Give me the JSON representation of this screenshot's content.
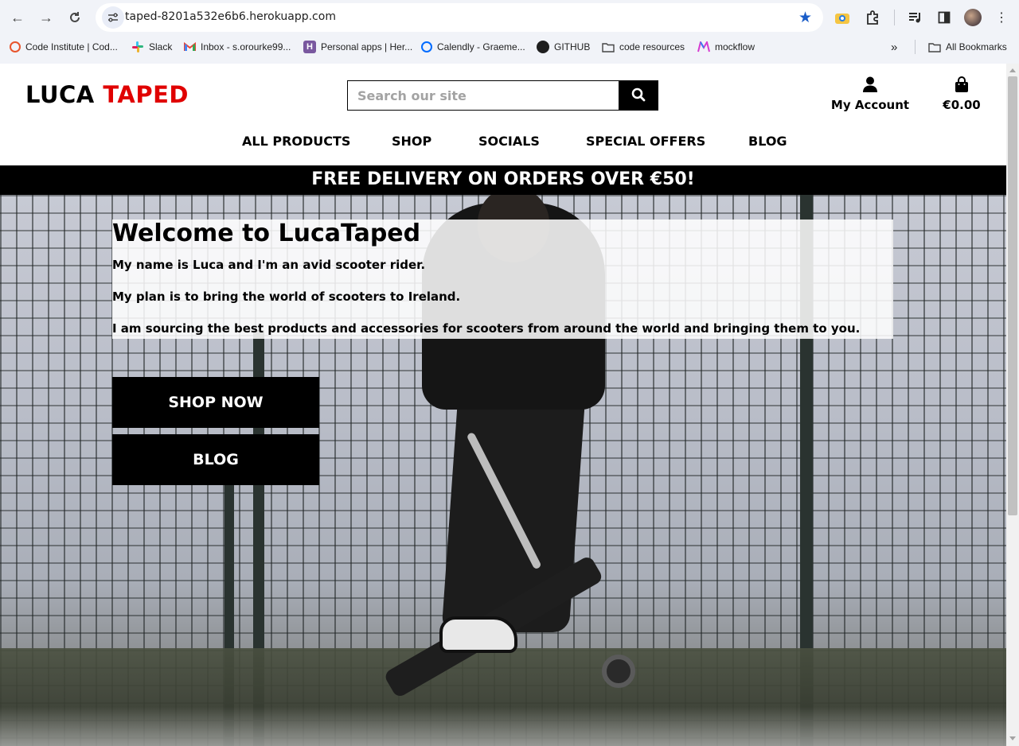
{
  "browser": {
    "url": "taped-8201a532e6b6.herokuapp.com",
    "bookmarks": [
      {
        "label": "Code Institute | Cod...",
        "icon": "code-institute-icon"
      },
      {
        "label": "Slack",
        "icon": "slack-icon"
      },
      {
        "label": "Inbox - s.orourke99...",
        "icon": "gmail-icon"
      },
      {
        "label": "Personal apps | Her...",
        "icon": "heroku-icon"
      },
      {
        "label": "Calendly - Graeme...",
        "icon": "calendly-icon"
      },
      {
        "label": "GITHUB",
        "icon": "github-icon"
      },
      {
        "label": "code resources",
        "icon": "folder-icon"
      },
      {
        "label": "mockflow",
        "icon": "mockflow-icon"
      }
    ],
    "overflow_label": "»",
    "all_bookmarks": "All Bookmarks"
  },
  "site": {
    "logo_part1": "LUCA",
    "logo_part2": "TAPED",
    "search_placeholder": "Search our site",
    "account_label": "My Account",
    "cart_total": "€0.00",
    "nav": [
      "ALL PRODUCTS",
      "SHOP",
      "SOCIALS",
      "SPECIAL OFFERS",
      "BLOG"
    ],
    "banner": "FREE DELIVERY ON ORDERS OVER €50!"
  },
  "hero": {
    "title": "Welcome to LucaTaped",
    "lines": [
      "My name is Luca and I'm an avid scooter rider.",
      "My plan is to bring the world of scooters to Ireland.",
      "I am sourcing the best products and accessories for scooters from around the world and bringing them to you."
    ],
    "shop_button": "SHOP NOW",
    "blog_button": "BLOG"
  },
  "colors": {
    "brand_red": "#e00000",
    "black": "#000000",
    "star_blue": "#1a5dc8"
  }
}
